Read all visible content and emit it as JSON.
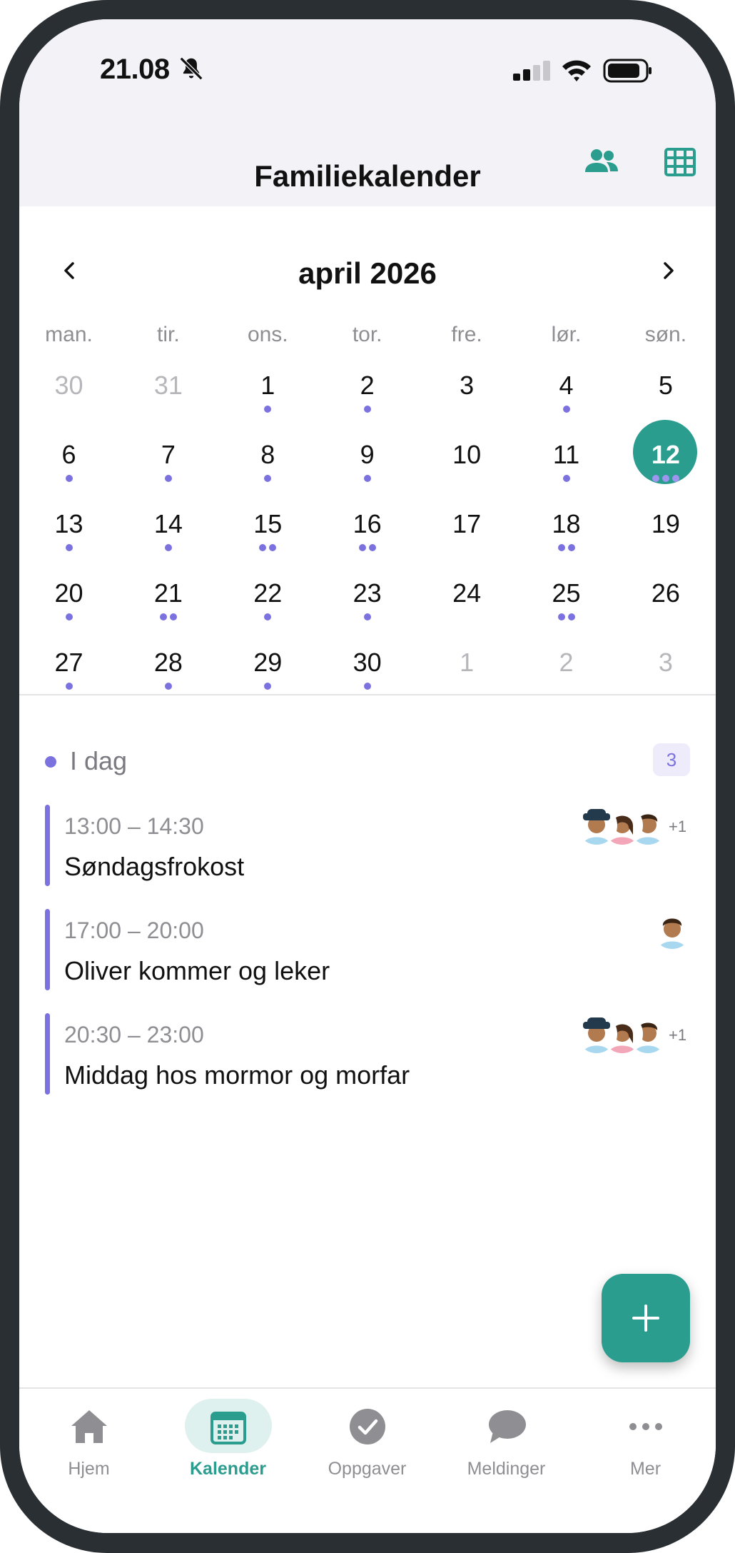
{
  "status_bar": {
    "time": "21.08"
  },
  "header": {
    "title": "Familiekalender"
  },
  "calendar": {
    "month_label": "april 2026",
    "weekdays": [
      "man.",
      "tir.",
      "ons.",
      "tor.",
      "fre.",
      "lør.",
      "søn."
    ],
    "weeks": [
      [
        {
          "day": "30",
          "muted": true,
          "dots": 0
        },
        {
          "day": "31",
          "muted": true,
          "dots": 0
        },
        {
          "day": "1",
          "dots": 1
        },
        {
          "day": "2",
          "dots": 1
        },
        {
          "day": "3",
          "dots": 0
        },
        {
          "day": "4",
          "dots": 1
        },
        {
          "day": "5",
          "dots": 0
        }
      ],
      [
        {
          "day": "6",
          "dots": 1
        },
        {
          "day": "7",
          "dots": 1
        },
        {
          "day": "8",
          "dots": 1
        },
        {
          "day": "9",
          "dots": 1
        },
        {
          "day": "10",
          "dots": 0
        },
        {
          "day": "11",
          "dots": 1
        },
        {
          "day": "12",
          "dots": 3,
          "today": true
        }
      ],
      [
        {
          "day": "13",
          "dots": 1
        },
        {
          "day": "14",
          "dots": 1
        },
        {
          "day": "15",
          "dots": 2
        },
        {
          "day": "16",
          "dots": 2
        },
        {
          "day": "17",
          "dots": 0
        },
        {
          "day": "18",
          "dots": 2
        },
        {
          "day": "19",
          "dots": 0
        }
      ],
      [
        {
          "day": "20",
          "dots": 1
        },
        {
          "day": "21",
          "dots": 2
        },
        {
          "day": "22",
          "dots": 1
        },
        {
          "day": "23",
          "dots": 1
        },
        {
          "day": "24",
          "dots": 0
        },
        {
          "day": "25",
          "dots": 2
        },
        {
          "day": "26",
          "dots": 0
        }
      ],
      [
        {
          "day": "27",
          "dots": 1
        },
        {
          "day": "28",
          "dots": 1
        },
        {
          "day": "29",
          "dots": 1
        },
        {
          "day": "30",
          "dots": 1
        },
        {
          "day": "1",
          "muted": true,
          "dots": 0
        },
        {
          "day": "2",
          "muted": true,
          "dots": 0
        },
        {
          "day": "3",
          "muted": true,
          "dots": 0
        }
      ]
    ]
  },
  "today_section": {
    "title": "I dag",
    "count": "3",
    "events": [
      {
        "time": "13:00 – 14:30",
        "title": "Søndagsfrokost",
        "avatars": [
          "hat-person",
          "woman",
          "man"
        ],
        "more": "+1"
      },
      {
        "time": "17:00 – 20:00",
        "title": "Oliver kommer og leker",
        "avatars": [
          "man"
        ],
        "more": ""
      },
      {
        "time": "20:30 – 23:00",
        "title": "Middag hos mormor og morfar",
        "avatars": [
          "hat-person",
          "woman",
          "man"
        ],
        "more": "+1"
      }
    ]
  },
  "fab": {
    "icon": "plus-icon"
  },
  "tabs": [
    {
      "label": "Hjem",
      "icon": "home-icon",
      "active": false
    },
    {
      "label": "Kalender",
      "icon": "calendar-icon",
      "active": true
    },
    {
      "label": "Oppgaver",
      "icon": "check-circle-icon",
      "active": false
    },
    {
      "label": "Meldinger",
      "icon": "chat-bubble-icon",
      "active": false
    },
    {
      "label": "Mer",
      "icon": "more-dots-icon",
      "active": false
    }
  ],
  "colors": {
    "accent": "#2a9d8f",
    "event": "#7b72e0",
    "muted": "#8e8e93"
  }
}
